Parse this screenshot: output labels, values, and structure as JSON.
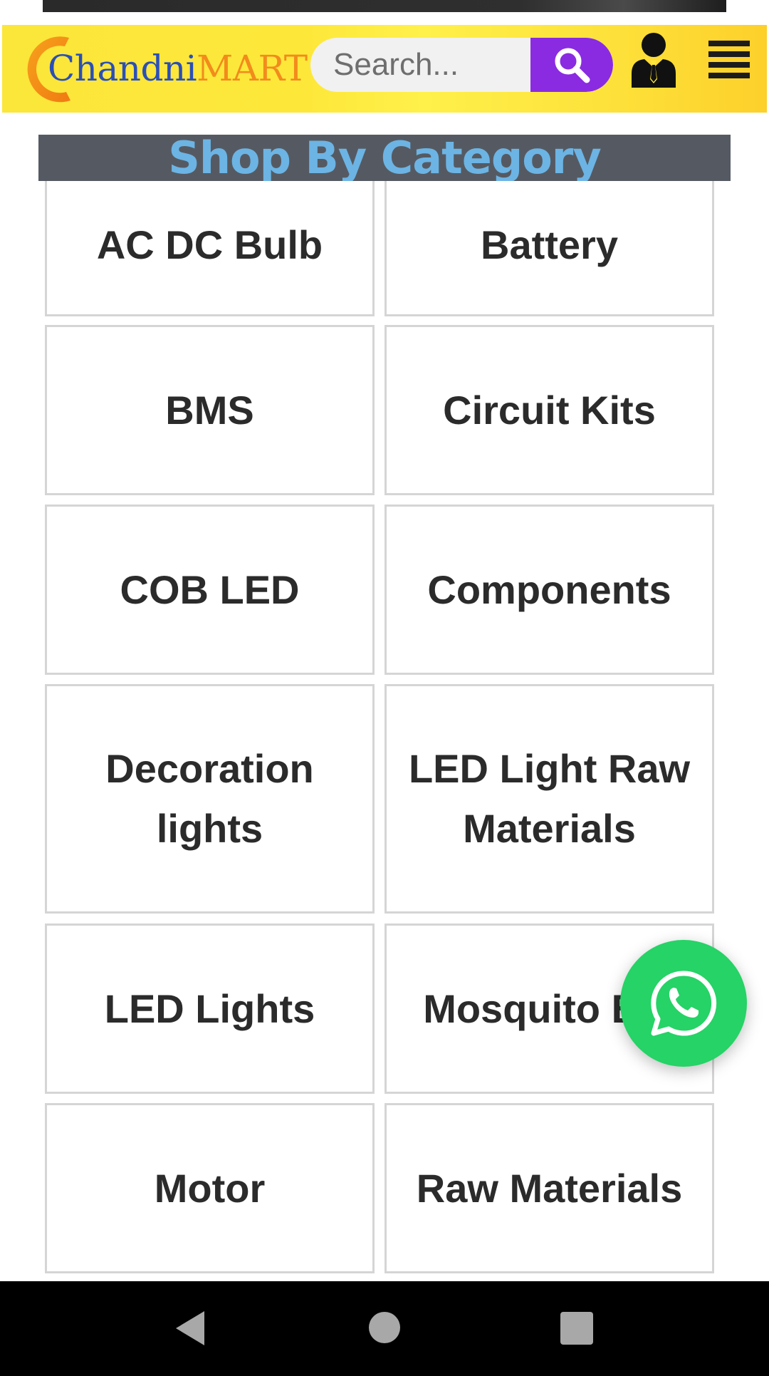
{
  "header": {
    "logo": {
      "part1": "Chandni",
      "part2": "MART"
    },
    "search": {
      "placeholder": "Search..."
    },
    "icons": {
      "search": "search-icon",
      "user": "user-icon",
      "menu": "hamburger-menu-icon"
    }
  },
  "section": {
    "title": "Shop By Category"
  },
  "categories": [
    "AC DC Bulb",
    "Battery",
    "BMS",
    "Circuit Kits",
    "COB LED",
    "Components",
    "Decoration lights",
    "LED Light Raw Materials",
    "LED Lights",
    "Mosquito Bat",
    "Motor",
    "Raw Materials"
  ],
  "floating": {
    "icon": "whatsapp-icon"
  },
  "system_nav": {
    "back": "back-icon",
    "home": "home-icon",
    "recents": "recents-icon"
  },
  "colors": {
    "header_bg": "#fde83a",
    "search_button": "#8a2be2",
    "title_bar_bg": "#555a62",
    "title_text": "#6cb4e4",
    "logo_blue": "#2a4fb8",
    "logo_orange": "#f28b1c",
    "whatsapp_green": "#25d366"
  }
}
